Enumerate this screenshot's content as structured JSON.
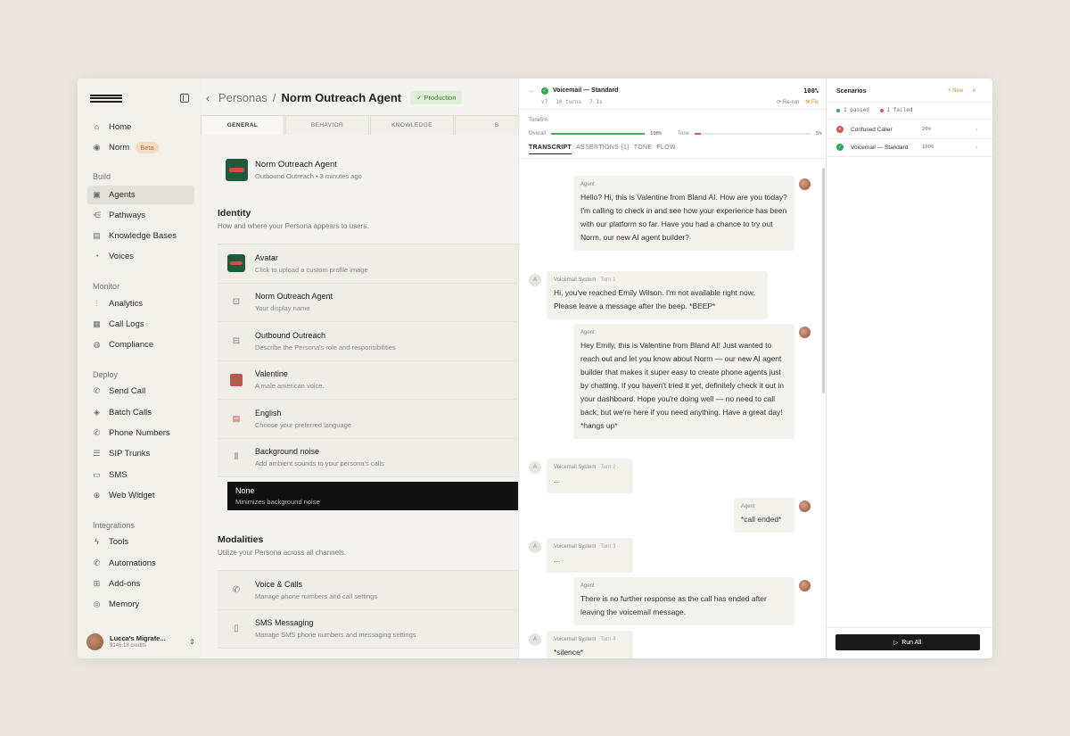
{
  "sidebar": {
    "top_items": [
      {
        "label": "Home",
        "icon": "home-icon"
      },
      {
        "label": "Norm",
        "icon": "norm-icon",
        "badge": "Beta"
      }
    ],
    "build_label": "Build",
    "build_items": [
      {
        "label": "Agents",
        "icon": "agents-icon",
        "active": true
      },
      {
        "label": "Pathways",
        "icon": "pathways-icon"
      },
      {
        "label": "Knowledge Bases",
        "icon": "knowledge-icon"
      },
      {
        "label": "Voices",
        "icon": "voices-icon"
      }
    ],
    "monitor_label": "Monitor",
    "monitor_items": [
      {
        "label": "Analytics",
        "icon": "analytics-icon"
      },
      {
        "label": "Call Logs",
        "icon": "call-logs-icon"
      },
      {
        "label": "Compliance",
        "icon": "compliance-icon"
      }
    ],
    "deploy_label": "Deploy",
    "deploy_items": [
      {
        "label": "Send Call",
        "icon": "phone-icon"
      },
      {
        "label": "Batch Calls",
        "icon": "batch-icon"
      },
      {
        "label": "Phone Numbers",
        "icon": "phone-numbers-icon"
      },
      {
        "label": "SIP Trunks",
        "icon": "sip-icon"
      },
      {
        "label": "SMS",
        "icon": "sms-icon"
      },
      {
        "label": "Web Widget",
        "icon": "globe-icon"
      }
    ],
    "integrations_label": "Integrations",
    "integrations_items": [
      {
        "label": "Tools",
        "icon": "tools-icon"
      },
      {
        "label": "Automations",
        "icon": "automations-icon"
      },
      {
        "label": "Add-ons",
        "icon": "addons-icon"
      },
      {
        "label": "Memory",
        "icon": "memory-icon"
      }
    ],
    "user": {
      "name": "Lucca's Migrate...",
      "credits": "9146.18 credits"
    }
  },
  "editor": {
    "breadcrumb_parent": "Personas",
    "breadcrumb_sep": "/",
    "title": "Norm Outreach Agent",
    "status_badge": "Production",
    "tabs": [
      "GENERAL",
      "BEHAVIOR",
      "KNOWLEDGE",
      "S"
    ],
    "agent_name": "Norm Outreach Agent",
    "agent_sub": "Outbound Outreach • 3 minutes ago",
    "identity_title": "Identity",
    "identity_desc": "How and where your Persona appears to users.",
    "identity_rows": [
      {
        "label": "Avatar",
        "desc": "Click to upload a custom profile image"
      },
      {
        "label": "Norm Outreach Agent",
        "desc": "Your display name"
      },
      {
        "label": "Outbound Outreach",
        "desc": "Describe the Persona's role and responsibilities"
      },
      {
        "label": "Valentine",
        "desc": "A male american voice."
      },
      {
        "label": "English",
        "desc": "Choose your preferred language"
      },
      {
        "label": "Background noise",
        "desc": "Add ambient sounds to your persona's calls"
      }
    ],
    "dropdown": {
      "label": "None",
      "desc": "Minimizes background noise"
    },
    "modalities_title": "Modalities",
    "modalities_desc": "Utilize your Persona across all channels.",
    "modality_rows": [
      {
        "label": "Voice & Calls",
        "desc": "Manage phone numbers and call settings"
      },
      {
        "label": "SMS Messaging",
        "desc": "Manage SMS phone numbers and messaging settings"
      }
    ]
  },
  "transcript": {
    "title": "Voicemail — Standard",
    "score": "100%",
    "meta": [
      "v7",
      "10 turns",
      "7.1s"
    ],
    "rerun": "⟳ Re-run",
    "fix": "⚒ Fix",
    "tone_line": "Tone5%",
    "overall_label": "Overall",
    "overall_value": "100%",
    "overall_fraction": 1.0,
    "tone_label": "Tone",
    "tone_value": "5%",
    "tone_fraction": 0.05,
    "tabs": [
      "TRANSCRIPT",
      "ASSERTIONS (1)",
      "TONE",
      "FLOW"
    ],
    "messages": [
      {
        "role": "Agent",
        "text": "Hello? Hi, this is Valentine from Bland AI. How are you today? I'm calling to check in and see how your experience has been with our platform so far. Have you had a chance to try out Norm, our new AI agent builder?"
      },
      {
        "role": "Voicemail System",
        "turn": "Turn 1",
        "text": "Hi, you've reached Emily Wilson. I'm not available right now. Please leave a message after the beep. *BEEP*"
      },
      {
        "role": "Agent",
        "text": "Hey Emily, this is Valentine from Bland AI! Just wanted to reach out and let you know about Norm — our new AI agent builder that makes it super easy to create phone agents just by chatting. If you haven't tried it yet, definitely check it out in your dashboard. Hope you're doing well — no need to call back, but we're here if you need anything. Have a great day! *hangs up*"
      },
      {
        "role": "Voicemail System",
        "turn": "Turn 2",
        "text": "..."
      },
      {
        "role": "Agent",
        "text": "*call ended*"
      },
      {
        "role": "Voicemail System",
        "turn": "Turn 3",
        "text": "..."
      },
      {
        "role": "Agent",
        "text": "There is no further response as the call has ended after leaving the voicemail message."
      },
      {
        "role": "Voicemail System",
        "turn": "Turn 4",
        "text": "*silence*"
      }
    ]
  },
  "scenarios": {
    "title": "Scenarios",
    "new_label": "+ New",
    "passed": "1 passed",
    "failed": "1 failed",
    "items": [
      {
        "name": "Confused Caller",
        "score": "20%",
        "status": "failed"
      },
      {
        "name": "Voicemail — Standard",
        "score": "100%",
        "status": "passed"
      }
    ],
    "run_all": "Run All"
  },
  "colors": {
    "accent_orange": "#d2852f",
    "pass_green": "#2fa84f",
    "fail_red": "#d9534f",
    "bar_green": "#4caf50",
    "bar_red": "#e0574f"
  }
}
